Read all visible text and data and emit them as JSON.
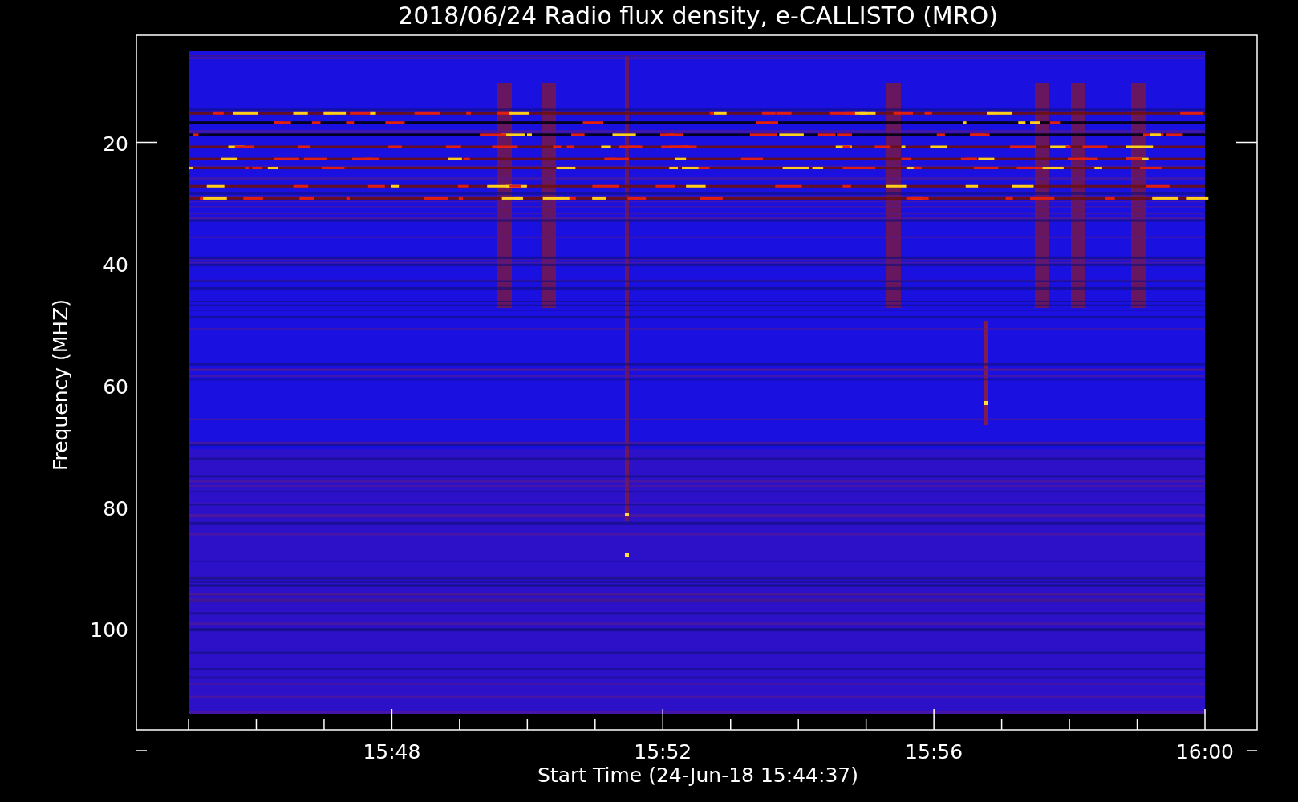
{
  "title": "2018/06/24  Radio flux density, e-CALLISTO (MRO)",
  "y_axis": {
    "label": "Frequency (MHZ)",
    "ticks": [
      "20",
      "40",
      "60",
      "80",
      "100"
    ]
  },
  "x_axis": {
    "label": "Start Time (24-Jun-18 15:44:37)",
    "ticks": [
      "15:48",
      "15:52",
      "15:56",
      "16:00"
    ]
  }
}
